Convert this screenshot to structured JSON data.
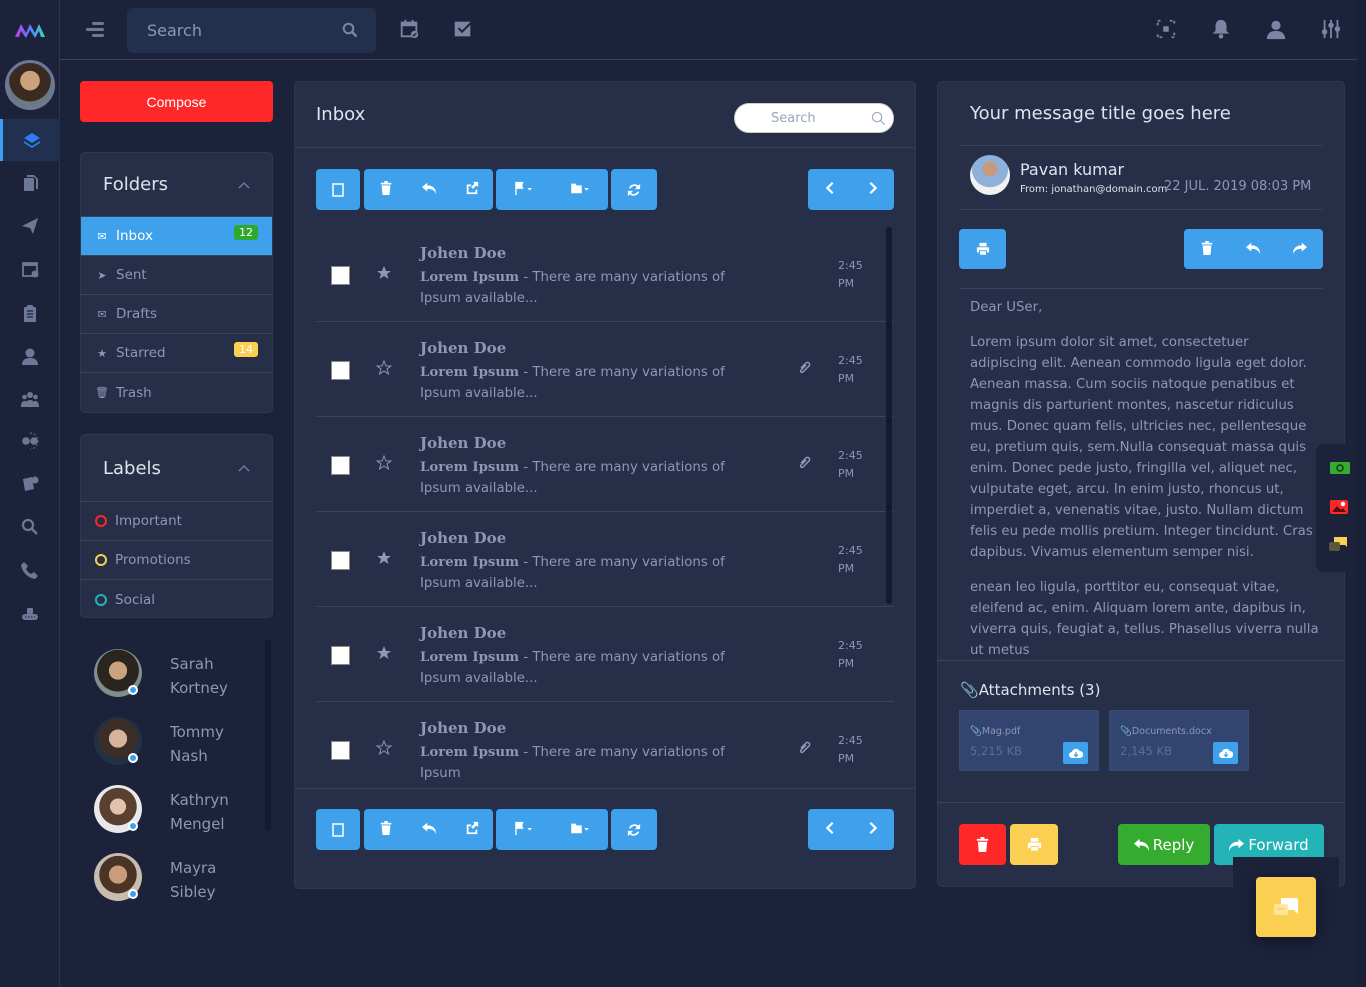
{
  "topbar": {
    "search_placeholder": "Search",
    "icons": [
      "menu-icon",
      "search-icon",
      "calendar-check-icon",
      "check-square-icon",
      "fullscreen-icon",
      "bell-icon",
      "user-icon",
      "sliders-icon"
    ]
  },
  "rail": {
    "items": [
      "layers-icon",
      "copy-icon",
      "send-icon",
      "calendar-icon",
      "clipboard-list-icon",
      "user-icon",
      "users-icon",
      "exchange-icon",
      "invoice-icon",
      "search-icon",
      "phone-icon",
      "lock-icon"
    ],
    "active_index": 0
  },
  "compose": {
    "label": "Compose"
  },
  "folders": {
    "title": "Folders",
    "items": [
      {
        "label": "Inbox",
        "icon": "envelope-icon",
        "badge": "12",
        "badge_color": "#2ea82e",
        "active": true
      },
      {
        "label": "Sent",
        "icon": "paper-plane-icon"
      },
      {
        "label": "Drafts",
        "icon": "envelope-draft-icon"
      },
      {
        "label": "Starred",
        "icon": "star-icon",
        "badge": "14",
        "badge_color": "#fbd052"
      },
      {
        "label": "Trash",
        "icon": "trash-icon"
      }
    ]
  },
  "labels": {
    "title": "Labels",
    "items": [
      {
        "label": "Important",
        "color": "#ff2828"
      },
      {
        "label": "Promotions",
        "color": "#fbd052"
      },
      {
        "label": "Social",
        "color": "#24b3b7"
      }
    ]
  },
  "contacts": [
    {
      "first": "Sarah",
      "last": "Kortney"
    },
    {
      "first": "Tommy",
      "last": "Nash"
    },
    {
      "first": "Kathryn",
      "last": "Mengel"
    },
    {
      "first": "Mayra",
      "last": "Sibley"
    }
  ],
  "inbox": {
    "title": "Inbox",
    "search_placeholder": "Search",
    "mails": [
      {
        "from": "Johen Doe",
        "subject": "Lorem Ipsum",
        "snippet": " - There are many variations of Ipsum available...",
        "time": "2:45",
        "ampm": "PM",
        "starred": true,
        "attachment": false
      },
      {
        "from": "Johen Doe",
        "subject": "Lorem Ipsum",
        "snippet": " - There are many variations of Ipsum available...",
        "time": "2:45",
        "ampm": "PM",
        "starred": false,
        "attachment": true
      },
      {
        "from": "Johen Doe",
        "subject": "Lorem Ipsum",
        "snippet": " - There are many variations of Ipsum available...",
        "time": "2:45",
        "ampm": "PM",
        "starred": false,
        "attachment": true
      },
      {
        "from": "Johen Doe",
        "subject": "Lorem Ipsum",
        "snippet": " - There are many variations of Ipsum available...",
        "time": "2:45",
        "ampm": "PM",
        "starred": true,
        "attachment": false
      },
      {
        "from": "Johen Doe",
        "subject": "Lorem Ipsum",
        "snippet": " - There are many variations of Ipsum available...",
        "time": "2:45",
        "ampm": "PM",
        "starred": true,
        "attachment": false
      },
      {
        "from": "Johen Doe",
        "subject": "Lorem Ipsum",
        "snippet": " - There are many variations of Ipsum",
        "time": "2:45",
        "ampm": "PM",
        "starred": false,
        "attachment": true
      }
    ]
  },
  "reader": {
    "title": "Your message title goes here",
    "sender_name": "Pavan kumar",
    "sender_from": "From: jonathan@domain.com",
    "date": "22 JUL. 2019 08:03 PM",
    "greeting": "Dear USer,",
    "paragraph1": "Lorem ipsum dolor sit amet, consectetuer adipiscing elit. Aenean commodo ligula eget dolor. Aenean massa. Cum sociis natoque penatibus et magnis dis parturient montes, nascetur ridiculus mus. Donec quam felis, ultricies nec, pellentesque eu, pretium quis, sem.Nulla consequat massa quis enim. Donec pede justo, fringilla vel, aliquet nec, vulputate eget, arcu. In enim justo, rhoncus ut, imperdiet a, venenatis vitae, justo. Nullam dictum felis eu pede mollis pretium. Integer tincidunt. Cras dapibus. Vivamus elementum semper nisi.",
    "paragraph2": "enean leo ligula, porttitor eu, consequat vitae, eleifend ac, enim. Aliquam lorem ante, dapibus in, viverra quis, feugiat a, tellus. Phasellus viverra nulla ut metus",
    "attachments_title": "Attachments (3)",
    "attachments": [
      {
        "name": "Mag.pdf",
        "size": "5,215 KB"
      },
      {
        "name": "Documents.docx",
        "size": "2,145 KB"
      }
    ],
    "reply_label": "Reply",
    "forward_label": "Forward"
  },
  "colors": {
    "accent": "#3fa0ec",
    "danger": "#ff2828",
    "warning": "#fbd052",
    "success": "#35ab30",
    "info": "#24b3b7"
  }
}
